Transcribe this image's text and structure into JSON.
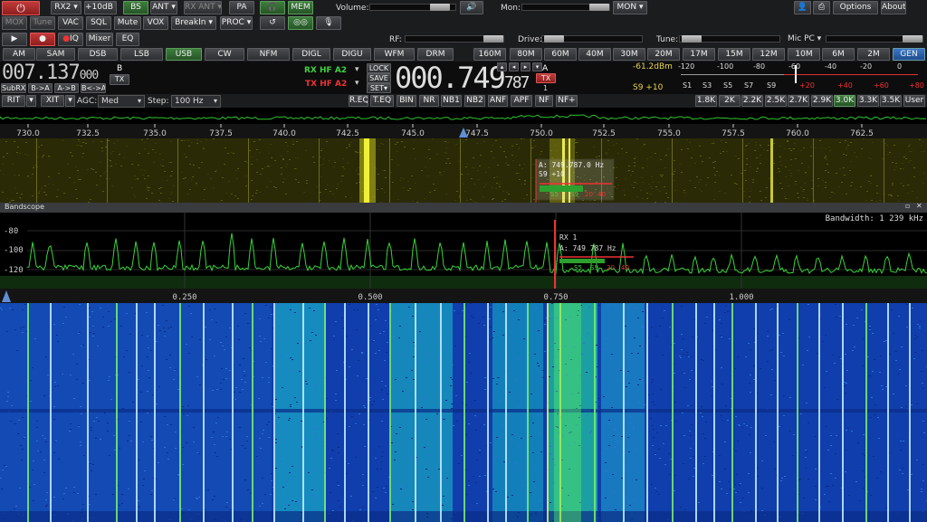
{
  "toolbar1": {
    "rx2": "RX2",
    "gain": "+10dB",
    "bs": "BS",
    "ant": "ANT",
    "rxant": "RX ANT",
    "pa": "PA",
    "mem": "MEM",
    "volume_label": "Volume:",
    "mon_label": "Mon:",
    "mon": "MON",
    "options": "Options",
    "about": "About"
  },
  "toolbar2": {
    "mox": "MOX",
    "tune": "Tune",
    "vac": "VAC",
    "sql": "SQL",
    "mute": "Mute",
    "vox": "VOX",
    "breakin": "BreakIn",
    "proc": "PROC"
  },
  "toolbar3": {
    "iq": "IQ",
    "mixer": "Mixer",
    "eq": "EQ",
    "rf_label": "RF:",
    "drive_label": "Drive:",
    "tune_label": "Tune:",
    "micpc": "Mic PC"
  },
  "modes": [
    "AM",
    "SAM",
    "DSB",
    "LSB",
    "USB",
    "CW",
    "NFM",
    "DIGL",
    "DIGU",
    "WFM",
    "DRM"
  ],
  "active_mode": "USB",
  "bands": [
    "160M",
    "80M",
    "60M",
    "40M",
    "30M",
    "20M",
    "17M",
    "15M",
    "12M",
    "10M",
    "6M",
    "2M",
    "GEN"
  ],
  "active_band": "GEN",
  "vfo_b": {
    "label": "B",
    "freq_main": "007.137",
    "freq_sub": "000",
    "tx": "TX",
    "subrx": "SubRX",
    "btoa": "B->A",
    "atob": "A->B",
    "swap": "B<->A"
  },
  "rxtx": {
    "rx": "RX HF  A2",
    "tx": "TX HF  A2",
    "lock": "LOCK",
    "save": "SAVE",
    "set": "SET"
  },
  "vfo_a": {
    "label": "A",
    "freq_main": "000.749",
    "freq_sub": "787",
    "tx": "TX",
    "num": "1"
  },
  "smeter": {
    "dbm": "-61.2dBm",
    "s_reading": "S9 +10",
    "top_scale": [
      "-120",
      "-100",
      "-80",
      "-60",
      "-40",
      "-20",
      "0"
    ],
    "bottom_scale": [
      "S1",
      "S3",
      "S5",
      "S7",
      "S9",
      "+20",
      "+40",
      "+60",
      "+80"
    ]
  },
  "row_rit": {
    "rit": "RIT",
    "xit": "XIT",
    "agc_label": "AGC:",
    "agc": "Med",
    "step_label": "Step:",
    "step": "100 Hz",
    "dsp": [
      "R.EQ",
      "T.EQ",
      "BIN",
      "NR",
      "NB1",
      "NB2",
      "ANF",
      "APF",
      "NF",
      "NF+"
    ],
    "filters": [
      "1.8K",
      "2K",
      "2.2K",
      "2.5K",
      "2.7K",
      "2.9K",
      "3.0K",
      "3.3K",
      "3.5K",
      "User"
    ],
    "active_filter": "3.0K"
  },
  "pan1": {
    "ticks": [
      "730.0",
      "732.5",
      "735.0",
      "737.5",
      "740.0",
      "742.5",
      "745.0",
      "747.5",
      "750.0",
      "752.5",
      "755.0",
      "757.5",
      "760.0",
      "762.5"
    ],
    "readout_freq": "A: 749.787.0 Hz",
    "readout_s": "S9 +10",
    "meter_labels": [
      "S5",
      "S9",
      "20",
      "40"
    ]
  },
  "bandscope": {
    "title": "Bandscope",
    "bandwidth": "Bandwidth: 1 239 kHz",
    "db_ticks": [
      "-80",
      "-100",
      "-120"
    ],
    "freq_ticks": [
      "0.250",
      "0.500",
      "0.750",
      "1.000"
    ],
    "rx_label": "RX 1",
    "readout": "A: 749 787 Hz",
    "s_labels": [
      "S5",
      "S9",
      "20",
      "40"
    ]
  },
  "colors": {
    "accent_green": "#3e7d3e",
    "gen_blue": "#3b78c8",
    "tx_red": "#c23a3a",
    "spectrum_green": "#39d339",
    "meter_yellow": "#e7d34a"
  }
}
